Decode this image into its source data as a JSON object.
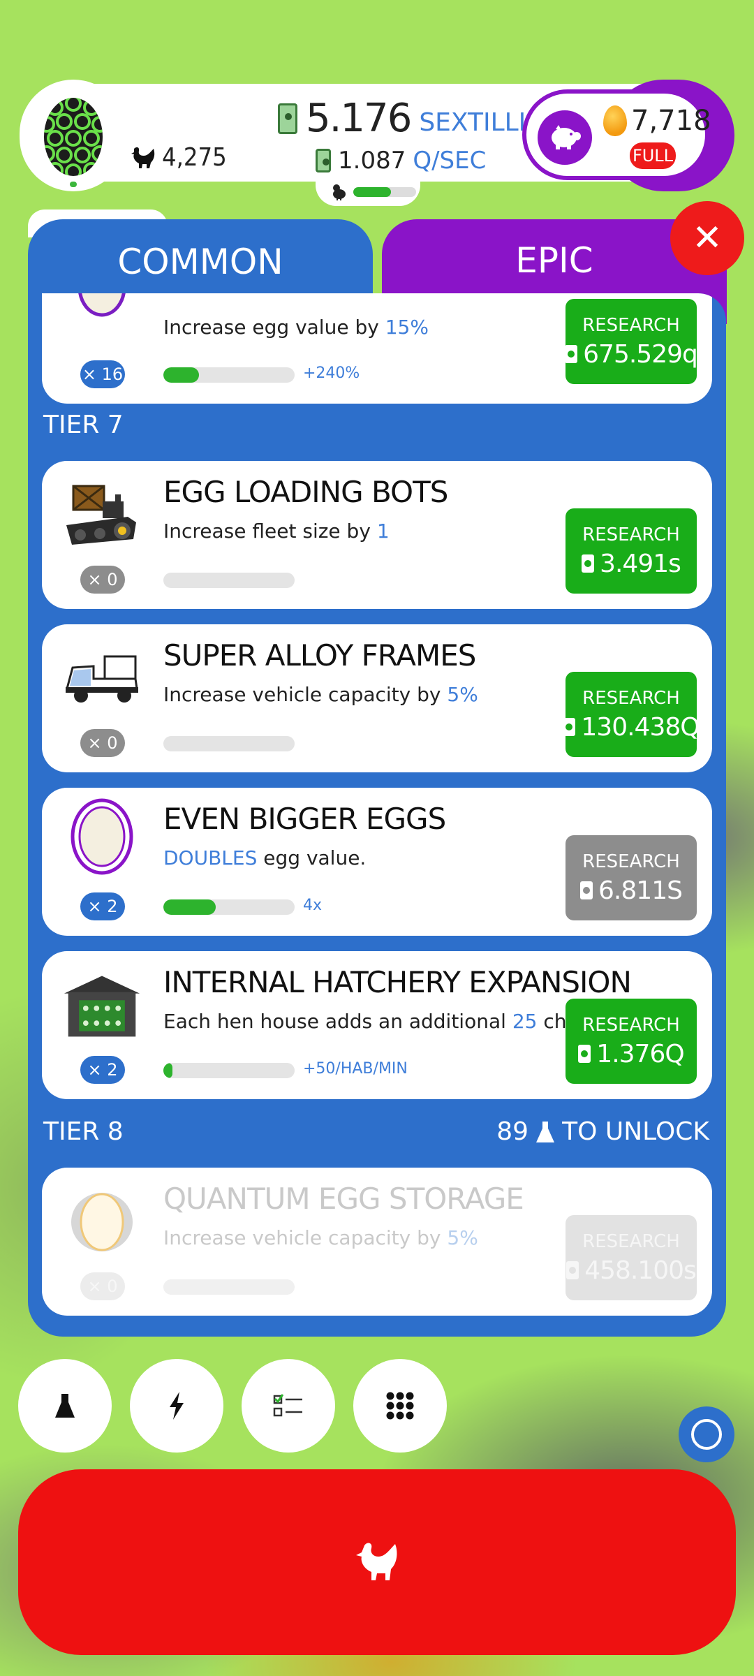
{
  "header": {
    "chicken_count": "4,275",
    "money_amount": "5.176",
    "money_unit": "SEXTILLION",
    "rate_amount": "1.087",
    "rate_unit": "Q/SEC",
    "progress_fraction": 0.6,
    "golden_eggs": "7,718",
    "full_badge": "FULL"
  },
  "tabs": {
    "common": "COMMON",
    "epic": "EPIC"
  },
  "close_icon": "close-icon",
  "research": {
    "partial_card": {
      "desc_prefix": "Increase egg value by ",
      "desc_value": "15%",
      "level": "× 16",
      "bar_label": "+240%",
      "progress": 0.27,
      "button_label": "RESEARCH",
      "cost": "675.529q"
    },
    "tier7_label": "TIER 7",
    "tier8_label": "TIER 8",
    "tier8_unlock_count": "89",
    "tier8_unlock_text": "TO UNLOCK",
    "cards": [
      {
        "title": "EGG LOADING BOTS",
        "desc_prefix": "Increase fleet size by ",
        "desc_value": "1",
        "desc_suffix": "",
        "level": "× 0",
        "bar_label": "",
        "progress": 0,
        "button_label": "RESEARCH",
        "cost": "3.491s"
      },
      {
        "title": "SUPER ALLOY FRAMES",
        "desc_prefix": "Increase vehicle capacity by ",
        "desc_value": "5%",
        "desc_suffix": "",
        "level": "× 0",
        "bar_label": "",
        "progress": 0,
        "button_label": "RESEARCH",
        "cost": "130.438Q"
      },
      {
        "title": "EVEN BIGGER EGGS",
        "desc_prefix": "",
        "desc_value": "DOUBLES",
        "desc_suffix": " egg value.",
        "level": "× 2",
        "bar_label": "4x",
        "progress": 0.4,
        "button_label": "RESEARCH",
        "cost": "6.811S"
      },
      {
        "title": "INTERNAL HATCHERY EXPANSION",
        "desc_prefix": "Each hen house adds an additional ",
        "desc_value": "25",
        "desc_suffix": " chickens/min",
        "level": "× 2",
        "bar_label": "+50/HAB/MIN",
        "progress": 0.07,
        "button_label": "RESEARCH",
        "cost": "1.376Q"
      },
      {
        "title": "QUANTUM EGG STORAGE",
        "desc_prefix": "Increase vehicle capacity by ",
        "desc_value": "5%",
        "desc_suffix": "",
        "level": "× 0",
        "bar_label": "",
        "progress": 0,
        "button_label": "RESEARCH",
        "cost": "458.100s"
      }
    ]
  },
  "bottom_icons": [
    "flask-icon",
    "lightning-icon",
    "checklist-icon",
    "grid-icon"
  ],
  "colors": {
    "accent_blue": "#2d6fcb",
    "epic_purple": "#8a14c8",
    "research_green": "#19ad19",
    "hatch_red": "#ee1111"
  }
}
